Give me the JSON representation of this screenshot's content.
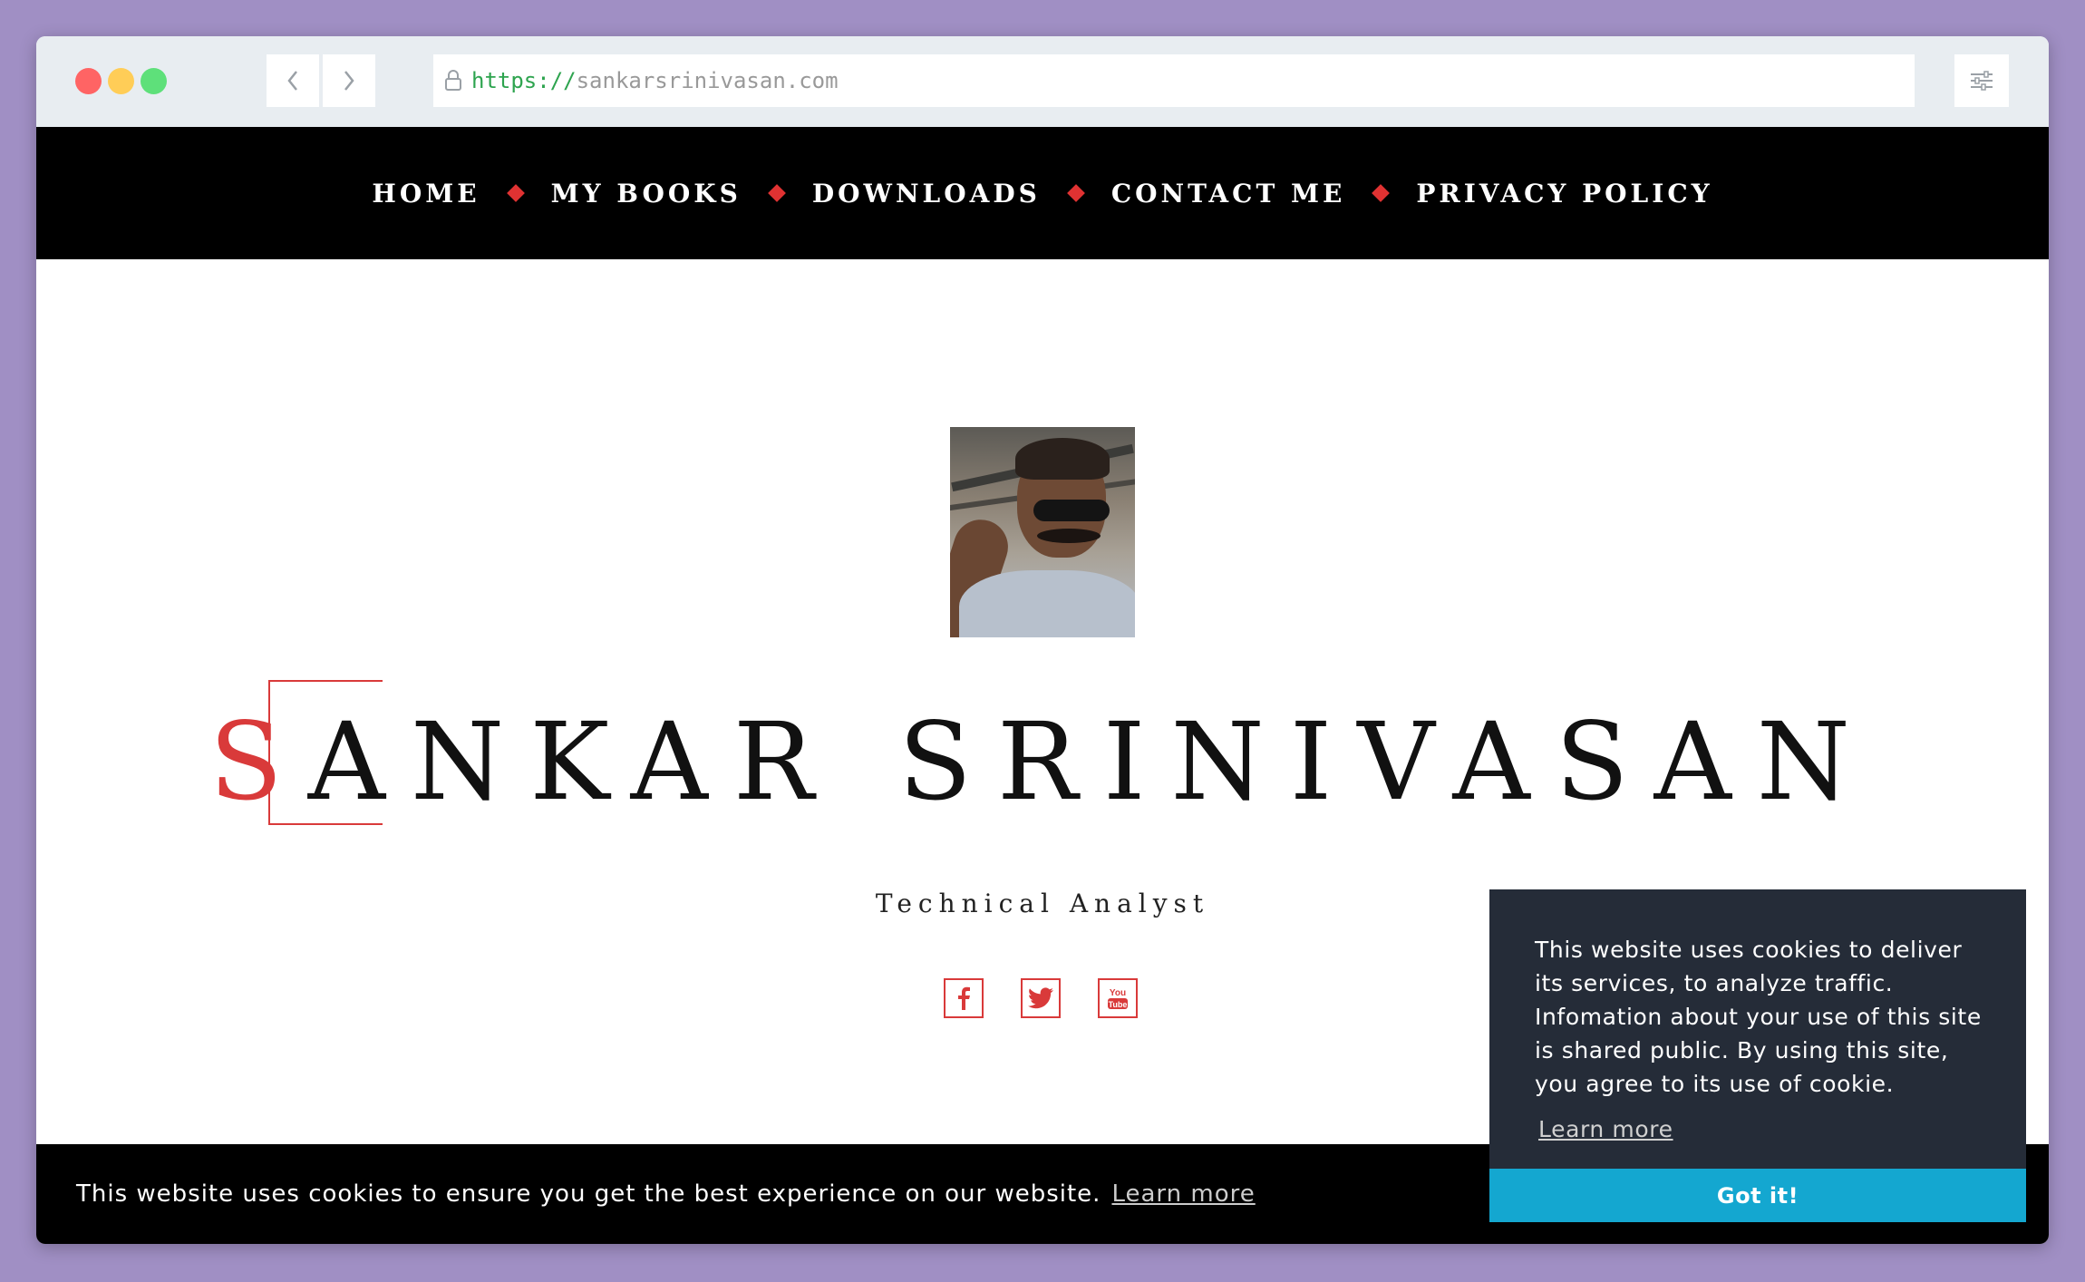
{
  "browser": {
    "url_scheme": "https://",
    "url_host": "sankarsrinivasan.com"
  },
  "nav": {
    "items": [
      "HOME",
      "MY BOOKS",
      "DOWNLOADS",
      "CONTACT ME",
      "PRIVACY POLICY"
    ]
  },
  "hero": {
    "name_first_letter": "S",
    "name_rest": "ANKAR SRINIVASAN",
    "subtitle": "Technical Analyst"
  },
  "social": {
    "youtube_label": "You Tube"
  },
  "cookie_bar": {
    "message": "This website uses cookies to ensure you get the best experience on our website.",
    "learn_more": "Learn more"
  },
  "cookie_popup": {
    "message": "This website uses cookies to deliver its services, to analyze traffic. Infomation about your use of this site is shared public. By using this site, you agree to its use of cookie.",
    "learn_more": "Learn more",
    "accept": "Got it!"
  },
  "colors": {
    "accent": "#d93a3a",
    "nav_background": "#000000",
    "popup_background": "#252c38",
    "accept_button": "#14a7d0",
    "outer_background": "#a08fc4"
  }
}
